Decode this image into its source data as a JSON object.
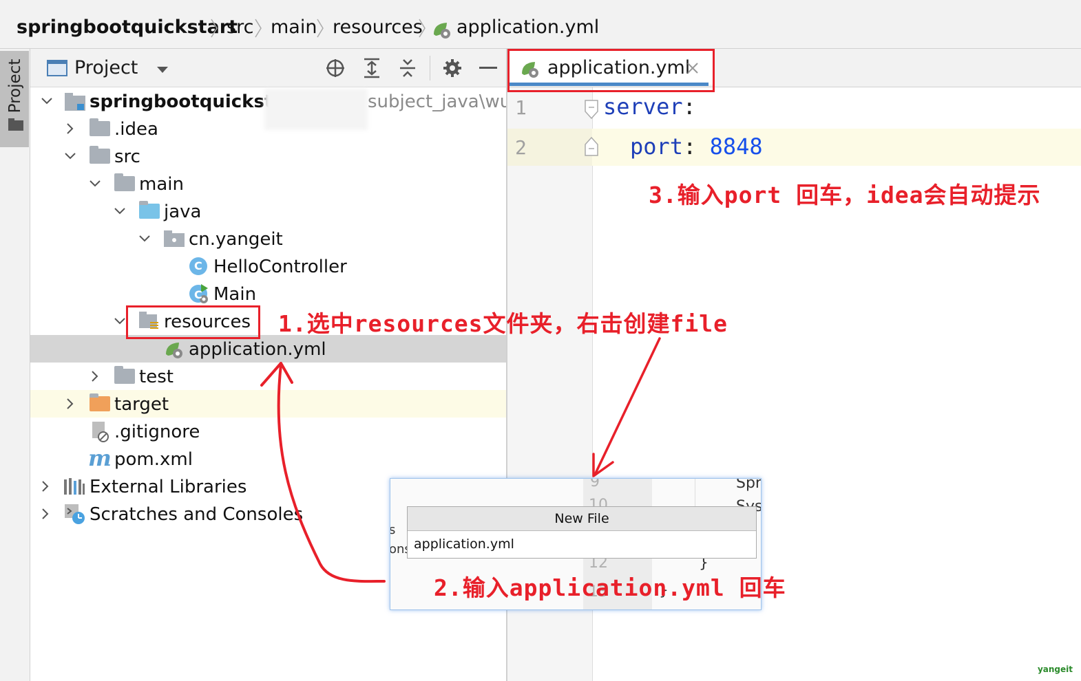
{
  "breadcrumb": [
    "springbootquickstart",
    "src",
    "main",
    "resources",
    "application.yml"
  ],
  "project_panel": {
    "title": "Project",
    "tree": {
      "root_name": "springbootquicksta",
      "root_path_fragment": "subject_java\\wu",
      "idea": ".idea",
      "src": "src",
      "main": "main",
      "java": "java",
      "package": "cn.yangeit",
      "hello_controller": "HelloController",
      "main_class": "Main",
      "resources": "resources",
      "application_yml": "application.yml",
      "test": "test",
      "target": "target",
      "gitignore": ".gitignore",
      "pom": "pom.xml",
      "external_libraries": "External Libraries",
      "scratches": "Scratches and Consoles"
    },
    "class_badge": "C"
  },
  "editor": {
    "tab_label": "application.yml",
    "line_numbers": [
      "1",
      "2"
    ],
    "code": {
      "server_key": "server",
      "colon": ":",
      "port_key": "port",
      "port_value": "8848"
    }
  },
  "dialog": {
    "title": "New File",
    "input_value": "application.yml",
    "bg_numbers": [
      "9",
      "10",
      "12",
      "13"
    ],
    "bg_fragments": [
      "Spr",
      "Sys",
      "s",
      "ons",
      "}",
      "}"
    ]
  },
  "annotations": {
    "step1": "1.选中resources文件夹，右击创建file",
    "step2": "2.输入application.yml 回车",
    "step3": "3.输入port 回车，idea会自动提示"
  },
  "watermark": "yangeit",
  "colors": {
    "annotation_red": "#e8202a",
    "yaml_key": "#1e3fb8",
    "yaml_number": "#1750eb",
    "spring_green": "#6aa84f",
    "folder_blue": "#79c3e8",
    "folder_orange": "#f0a05a"
  }
}
